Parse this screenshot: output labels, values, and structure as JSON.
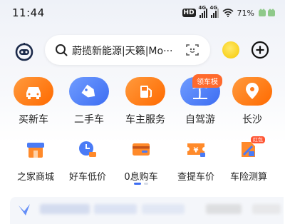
{
  "status_bar": {
    "time": "11:44",
    "hd_label": "HD",
    "net1_label": "4G",
    "net2_label": "4G",
    "battery_percent": "71%"
  },
  "search": {
    "query": "蔚揽新能源|天籁|Mo···"
  },
  "nav_top": [
    {
      "label": "买新车",
      "icon": "car-icon",
      "color": "#ff7a1a"
    },
    {
      "label": "二手车",
      "icon": "tag-icon",
      "color": "#4a7bf6"
    },
    {
      "label": "车主服务",
      "icon": "gas-station-icon",
      "color": "#ff7a1a"
    },
    {
      "label": "自驾游",
      "icon": "palm-tree-icon",
      "color": "#4a7bf6"
    },
    {
      "label": "长沙",
      "icon": "location-pin-icon",
      "color": "#ff7a1a"
    }
  ],
  "nav_top_badge": "领车模",
  "nav_second": [
    {
      "label": "之家商城",
      "icon": "shop-icon"
    },
    {
      "label": "好车低价",
      "icon": "clock-icon"
    },
    {
      "label": "0息购车",
      "icon": "card-icon"
    },
    {
      "label": "查提车价",
      "icon": "yuan-ticket-icon"
    },
    {
      "label": "车险测算",
      "icon": "insurance-calc-icon"
    }
  ],
  "nav_second_badge": "红包",
  "pager": {
    "pages": 2,
    "current": 1
  }
}
